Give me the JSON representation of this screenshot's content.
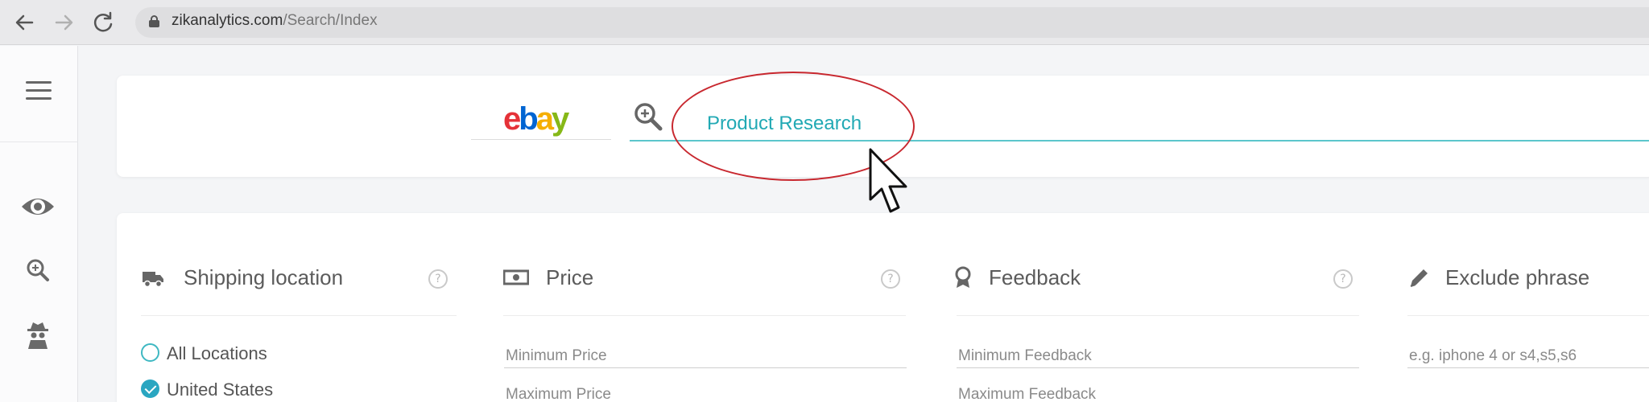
{
  "browser": {
    "url_domain": "zikanalytics.com",
    "url_path": "/Search/Index",
    "icons": [
      "back-arrow-icon",
      "forward-arrow-icon",
      "reload-icon",
      "lock-icon"
    ]
  },
  "sidebar": {
    "icons": [
      "hamburger-menu-icon",
      "eye-icon",
      "search-zoom-icon",
      "spy-icon"
    ]
  },
  "search": {
    "marketplace_logo": "ebay",
    "value": "Product Research"
  },
  "filters": {
    "shipping": {
      "title": "Shipping location",
      "icon": "truck-icon",
      "options": [
        {
          "label": "All Locations",
          "checked": false
        },
        {
          "label": "United States",
          "checked": true
        }
      ]
    },
    "price": {
      "title": "Price",
      "icon": "money-icon",
      "min_placeholder": "Minimum Price",
      "max_placeholder": "Maximum Price"
    },
    "feedback": {
      "title": "Feedback",
      "icon": "award-icon",
      "min_placeholder": "Minimum Feedback",
      "max_placeholder": "Maximum Feedback"
    },
    "exclude": {
      "title": "Exclude phrase",
      "icon": "pencil-icon",
      "placeholder": "e.g. iphone 4 or s4,s5,s6"
    }
  },
  "colors": {
    "accent": "#21a9b4",
    "annotation_red": "#c8282f"
  }
}
